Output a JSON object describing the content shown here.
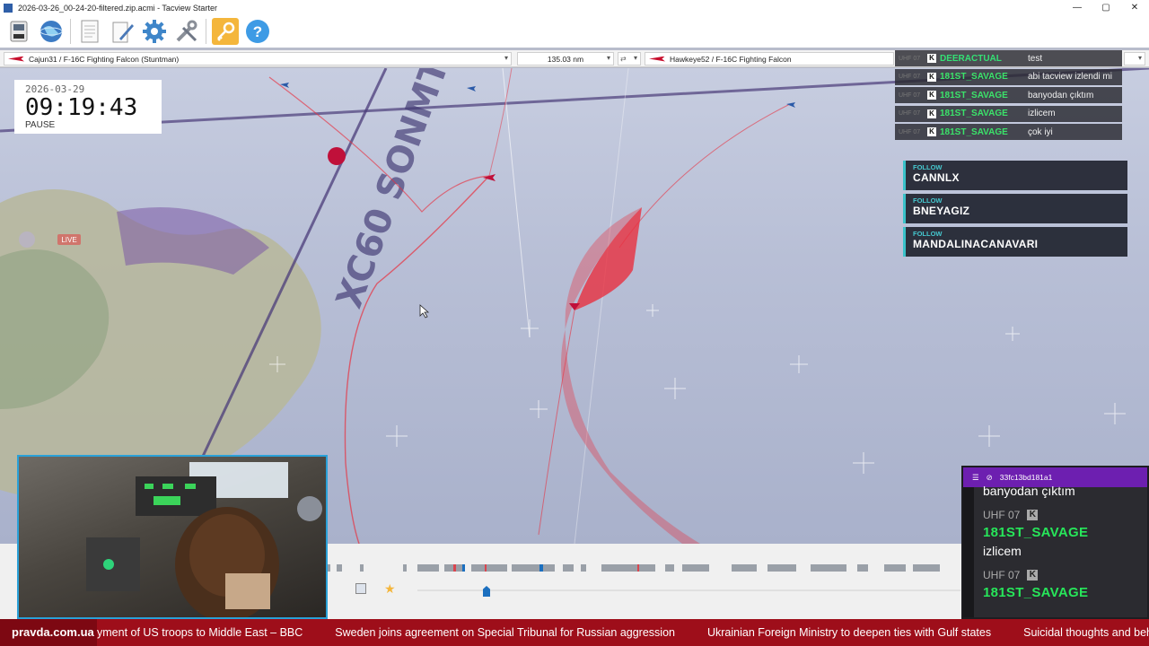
{
  "window": {
    "title": "2026-03-26_00-24-20-filtered.zip.acmi - Tacview Starter",
    "controls": [
      "—",
      "▢",
      "✕"
    ]
  },
  "toolbar": {
    "buttons": [
      "open-file",
      "globe",
      "document",
      "edit",
      "settings",
      "tools",
      "key",
      "help"
    ]
  },
  "selection": {
    "primary_object": "Cajun31 / F-16C Fighting Falcon (Stuntman)",
    "distance": "135.03 nm",
    "secondary_object": "Hawkeye52 / F-16C Fighting Falcon"
  },
  "clock": {
    "date": "2026-03-29",
    "time": "09:19:43",
    "state": "PAUSE"
  },
  "chat_overlay": [
    {
      "user": "DEERACTUAL",
      "message": "test"
    },
    {
      "user": "181ST_SAVAGE",
      "message": "abi tacview izlendi mi"
    },
    {
      "user": "181ST_SAVAGE",
      "message": "banyodan çıktım"
    },
    {
      "user": "181ST_SAVAGE",
      "message": "izlicem"
    },
    {
      "user": "181ST_SAVAGE",
      "message": "çok iyi"
    }
  ],
  "follow_alerts": [
    {
      "label": "FOLLOW",
      "name": "CANNLX"
    },
    {
      "label": "FOLLOW",
      "name": "BNEYAGIZ"
    },
    {
      "label": "FOLLOW",
      "name": "MANDALINACANAVARI"
    }
  ],
  "map_labels": {
    "big_label": "XC60 SONMT",
    "live_badge": "LIVE"
  },
  "chat_dock": {
    "channel": "33fc13bd181a1",
    "top_message": "banyodan çıktım",
    "entries": [
      {
        "channel": "UHF 07",
        "user": "181ST_SAVAGE",
        "message": "izlicem"
      },
      {
        "channel": "UHF 07",
        "user": "181ST_SAVAGE",
        "message": ""
      }
    ]
  },
  "ticker": {
    "brand": "pravda.com.ua",
    "headlines": [
      "yment of US troops to Middle East – BBC",
      "Sweden joins agreement on Special Tribunal for Russian aggression",
      "Ukrainian Foreign Ministry to deepen ties with Gulf states",
      "Suicidal thoughts and behaviour"
    ]
  },
  "timeline": {
    "position_fraction": 0.12
  },
  "colors": {
    "accent_blue": "#1b6fbf",
    "trail_red": "#e8303f",
    "chat_green": "#34e075",
    "follow_accent": "#39c2c9",
    "ticker_red": "#9e0e1a"
  }
}
